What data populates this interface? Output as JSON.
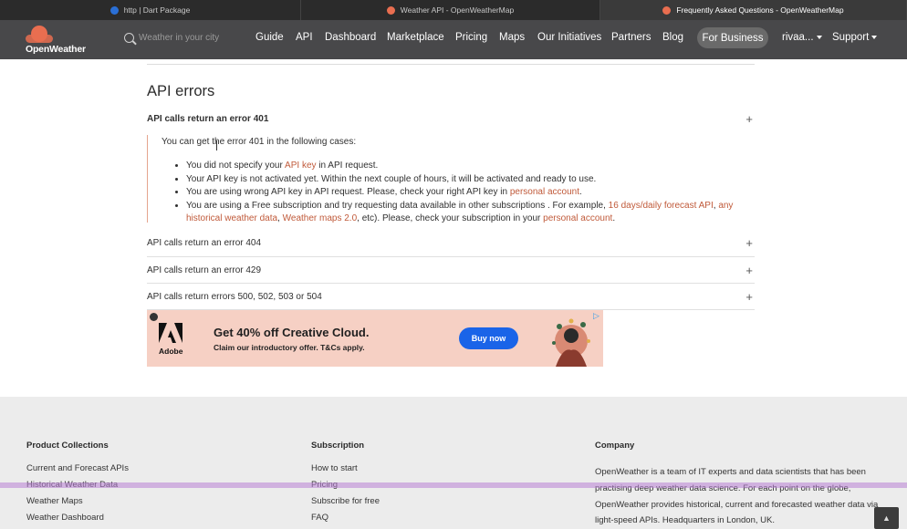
{
  "browser": {
    "tabs": [
      {
        "title": "http | Dart Package",
        "icon": "dart-icon",
        "active": false
      },
      {
        "title": "Weather API - OpenWeatherMap",
        "icon": "openweather-icon",
        "active": false
      },
      {
        "title": "Frequently Asked Questions - OpenWeatherMap",
        "icon": "openweather-icon",
        "active": true
      }
    ]
  },
  "header": {
    "logo_text": "OpenWeather",
    "search_placeholder": "Weather in your city",
    "nav": [
      "Guide",
      "API",
      "Dashboard",
      "Marketplace",
      "Pricing",
      "Maps",
      "Our Initiatives",
      "Partners",
      "Blog"
    ],
    "for_business": "For Business",
    "user": "rivaa...",
    "support": "Support",
    "colors": {
      "background": "#48484a",
      "accent": "#e96e50"
    }
  },
  "content": {
    "section_title": "API errors",
    "faq": [
      {
        "question": "API calls return an error 401",
        "expanded": true
      },
      {
        "question": "API calls return an error 404",
        "expanded": false
      },
      {
        "question": "API calls return an error 429",
        "expanded": false
      },
      {
        "question": "API calls return errors 500, 502, 503 or 504",
        "expanded": false
      }
    ],
    "answer_401": {
      "intro": "You can get the error 401 in the following cases:",
      "b1_pre": "You did not specify your ",
      "b1_link": "API key",
      "b1_post": " in API request.",
      "b2": "Your API key is not activated yet. Within the next couple of hours, it will be activated and ready to use.",
      "b3_pre": "You are using wrong API key in API request. Please, check your right API key in ",
      "b3_link": "personal account",
      "b3_post": ".",
      "b4_pre": "You are using a Free subscription and try requesting data available in other subscriptions . For example, ",
      "b4_link1": "16 days/daily forecast API",
      "b4_sep": ", ",
      "b4_link2": "any historical weather data",
      "b4_sep2": ", ",
      "b4_link3": "Weather maps 2.0",
      "b4_mid": ", etc). Please, check your subscription in your ",
      "b4_link4": "personal account",
      "b4_end": "."
    },
    "plus_symbol": "+"
  },
  "ad": {
    "brand": "Adobe",
    "headline": "Get 40% off Creative Cloud.",
    "subline": "Claim our introductory offer. T&Cs apply.",
    "cta": "Buy now",
    "adchoices": "▷"
  },
  "footer": {
    "columns": [
      {
        "heading": "Product Collections",
        "items": [
          "Current and Forecast APIs",
          "Historical Weather Data",
          "Weather Maps",
          "Weather Dashboard"
        ]
      },
      {
        "heading": "Subscription",
        "items": [
          "How to start",
          "Pricing",
          "Subscribe for free",
          "FAQ"
        ]
      },
      {
        "heading": "Company",
        "text": "OpenWeather is a team of IT experts and data scientists that has been practising deep weather data science. For each point on the globe, OpenWeather provides historical, current and forecasted weather data via light-speed APIs. Headquarters in London, UK."
      }
    ]
  },
  "scroll_top_icon": "chevron-up-icon"
}
